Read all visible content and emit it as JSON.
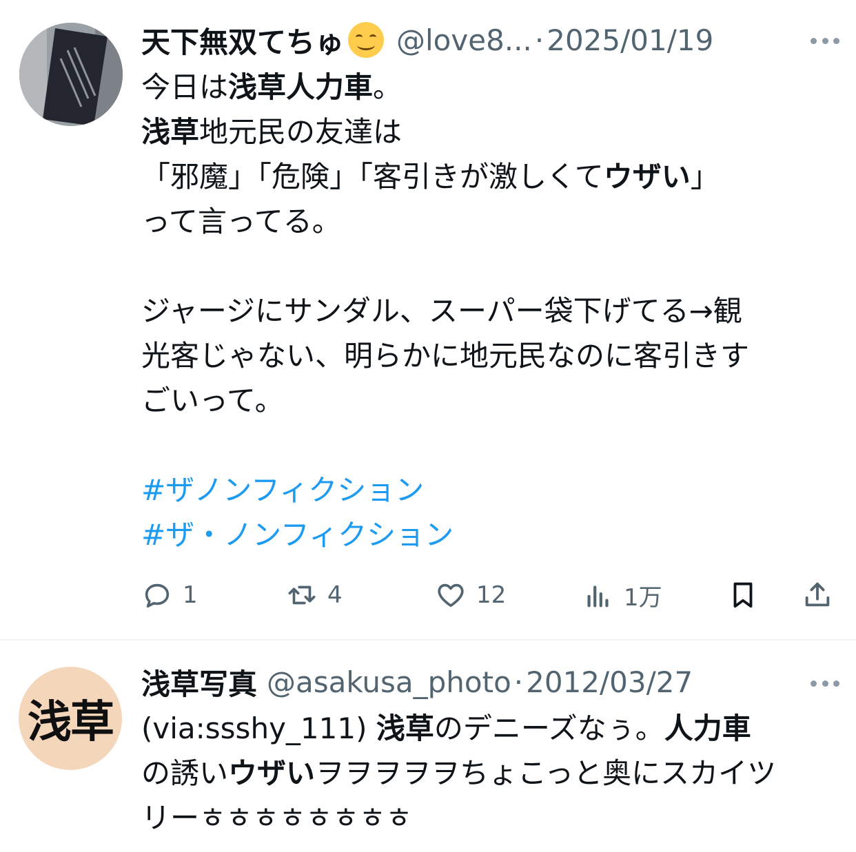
{
  "tweets": [
    {
      "author": "天下無双てちゅ",
      "emoji": "smiling-face-emoji",
      "handle": "@love8...",
      "separator": "·",
      "date": "2025/01/19",
      "body": [
        "今日は浅草人力車。",
        "浅草地元民の友達は",
        "「邪魔」「危険」「客引きが激しくてウザい」",
        "って言ってる。",
        "",
        "ジャージにサンダル、スーパー袋下げてる→観",
        "光客じゃない、明らかに地元民なのに客引きす",
        "ごいって。",
        ""
      ],
      "hashtags": [
        "#ザノンフィクション",
        "#ザ・ノンフィクション"
      ],
      "actions": {
        "reply": "1",
        "retweet": "4",
        "like": "12",
        "views": "1万"
      }
    },
    {
      "author": "浅草写真",
      "avatar_text": "浅草",
      "handle": "@asakusa_photo",
      "separator": "·",
      "date": "2012/03/27",
      "body": [
        "(via:ssshy_111) 浅草のデニーズなぅ。人力車",
        "の誘いウザいヲヲヲヲヲちょこっと奥にスカイツ",
        "リーㅎㅎㅎㅎㅎㅎㅎㅎ"
      ]
    }
  ],
  "colors": {
    "text": "#0f1419",
    "secondary": "#536471",
    "link": "#1d9bf0",
    "divider": "#eff3f4"
  }
}
